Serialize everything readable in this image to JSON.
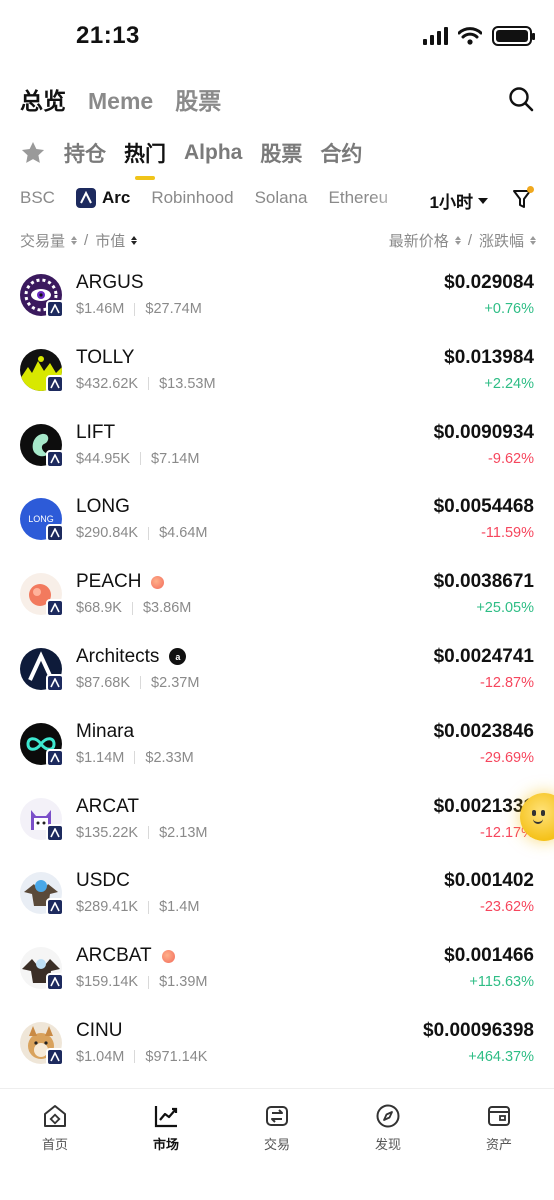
{
  "status_bar": {
    "time": "21:13"
  },
  "top_tabs": [
    "总览",
    "Meme",
    "股票"
  ],
  "category_tabs": [
    "持仓",
    "热门",
    "Alpha",
    "股票",
    "合约"
  ],
  "chains": [
    "BSC",
    "Arc",
    "Robinhood",
    "Solana",
    "Ethereu"
  ],
  "interval": "1小时",
  "sort": {
    "volume": "交易量",
    "divider": "/",
    "market_cap": "市值",
    "price": "最新价格",
    "change": "涨跌幅"
  },
  "tokens": [
    {
      "name": "ARGUS",
      "volume": "$1.46M",
      "market_cap": "$27.74M",
      "price": "$0.029084",
      "change": "+0.76%",
      "direction": "up",
      "tag": ""
    },
    {
      "name": "TOLLY",
      "volume": "$432.62K",
      "market_cap": "$13.53M",
      "price": "$0.013984",
      "change": "+2.24%",
      "direction": "up",
      "tag": ""
    },
    {
      "name": "LIFT",
      "volume": "$44.95K",
      "market_cap": "$7.14M",
      "price": "$0.0090934",
      "change": "-9.62%",
      "direction": "down",
      "tag": ""
    },
    {
      "name": "LONG",
      "volume": "$290.84K",
      "market_cap": "$4.64M",
      "price": "$0.0054468",
      "change": "-11.59%",
      "direction": "down",
      "tag": "",
      "logo_text": "LONG"
    },
    {
      "name": "PEACH",
      "volume": "$68.9K",
      "market_cap": "$3.86M",
      "price": "$0.0038671",
      "change": "+25.05%",
      "direction": "up",
      "tag": "dot"
    },
    {
      "name": "Architects",
      "volume": "$87.68K",
      "market_cap": "$2.37M",
      "price": "$0.0024741",
      "change": "-12.87%",
      "direction": "down",
      "tag": "badge"
    },
    {
      "name": "Minara",
      "volume": "$1.14M",
      "market_cap": "$2.33M",
      "price": "$0.0023846",
      "change": "-29.69%",
      "direction": "down",
      "tag": ""
    },
    {
      "name": "ARCAT",
      "volume": "$135.22K",
      "market_cap": "$2.13M",
      "price": "$0.0021331",
      "change": "-12.17%",
      "direction": "down",
      "tag": ""
    },
    {
      "name": "USDC",
      "volume": "$289.41K",
      "market_cap": "$1.4M",
      "price": "$0.001402",
      "change": "-23.62%",
      "direction": "down",
      "tag": ""
    },
    {
      "name": "ARCBAT",
      "volume": "$159.14K",
      "market_cap": "$1.39M",
      "price": "$0.001466",
      "change": "+115.63%",
      "direction": "up",
      "tag": "dot"
    },
    {
      "name": "CINU",
      "volume": "$1.04M",
      "market_cap": "$971.14K",
      "price": "$0.00096398",
      "change": "+464.37%",
      "direction": "up",
      "tag": ""
    }
  ],
  "bottom_nav": [
    "首页",
    "市场",
    "交易",
    "发现",
    "资产"
  ],
  "colors": {
    "up": "#2ebd85",
    "down": "#f6465d",
    "accent": "#f0c419",
    "arc_badge": "#1d2a5e"
  },
  "icons": [
    "search-icon",
    "star-icon",
    "filter-icon",
    "caret-down-icon",
    "home-icon",
    "chart-icon",
    "swap-icon",
    "compass-icon",
    "wallet-icon"
  ]
}
